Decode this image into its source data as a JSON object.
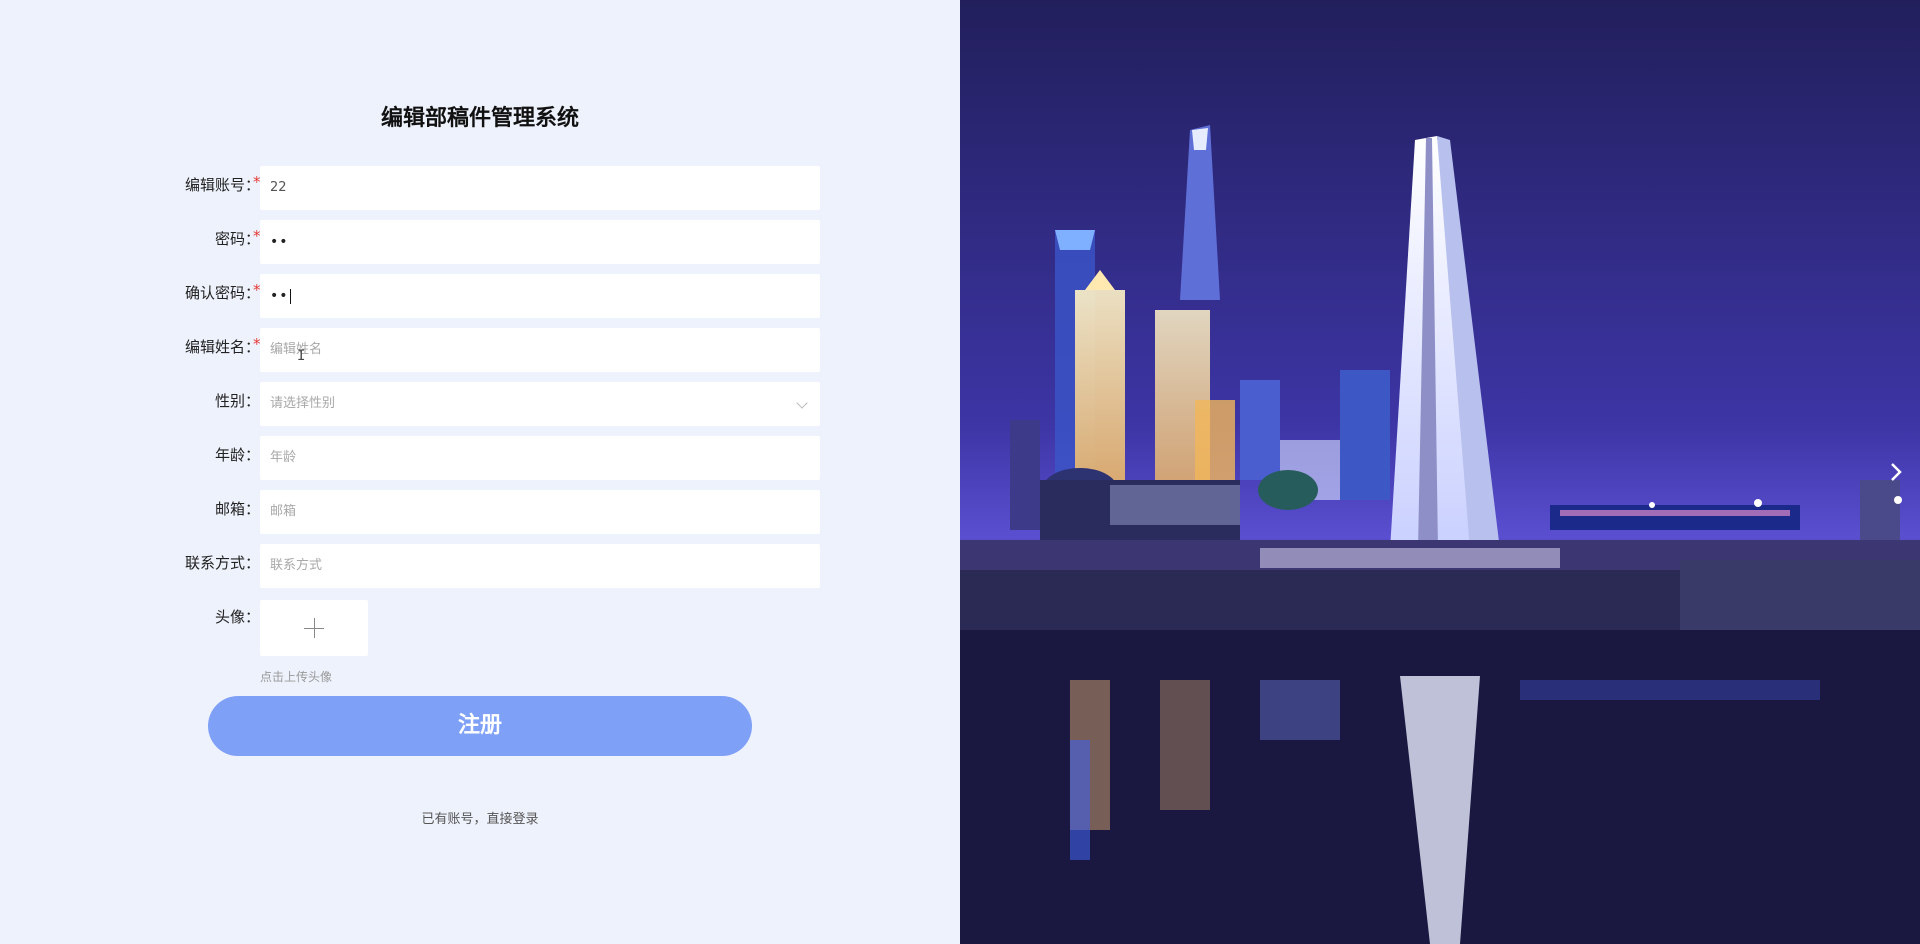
{
  "app": {
    "title": "编辑部稿件管理系统"
  },
  "form": {
    "account": {
      "label": "编辑账号：",
      "value": "22",
      "required": "*"
    },
    "password": {
      "label": "密码：",
      "value": "••",
      "required": "*"
    },
    "confirm_password": {
      "label": "确认密码：",
      "value": "••",
      "required": "*"
    },
    "name": {
      "label": "编辑姓名：",
      "placeholder": "编辑姓名",
      "required": "*"
    },
    "gender": {
      "label": "性别：",
      "placeholder": "请选择性别"
    },
    "age": {
      "label": "年龄：",
      "placeholder": "年龄"
    },
    "email": {
      "label": "邮箱：",
      "placeholder": "邮箱"
    },
    "contact": {
      "label": "联系方式：",
      "placeholder": "联系方式"
    },
    "avatar": {
      "label": "头像：",
      "hint": "点击上传头像"
    }
  },
  "actions": {
    "register": "注册",
    "login_link": "已有账号，直接登录"
  },
  "theme": {
    "accent": "#7fa0f7",
    "background": "#eef2fc",
    "required": "#e53935"
  },
  "icons": {
    "upload": "plus-icon",
    "select": "chevron-down-icon",
    "carousel_next": "chevron-right-icon"
  }
}
